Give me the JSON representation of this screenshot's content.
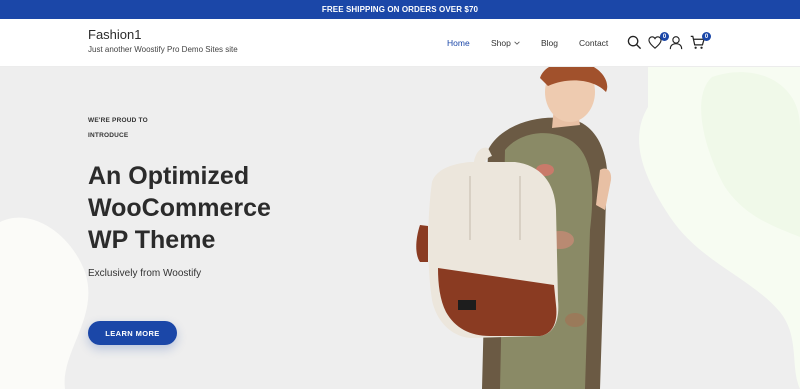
{
  "announcement": "FREE SHIPPING ON ORDERS OVER $70",
  "site": {
    "title": "Fashion1",
    "tagline": "Just another Woostify Pro Demo Sites site"
  },
  "nav": {
    "home": "Home",
    "shop": "Shop",
    "blog": "Blog",
    "contact": "Contact"
  },
  "header_icons": {
    "search": "search-icon",
    "wishlist": "heart-icon",
    "wishlist_count": "0",
    "account": "user-icon",
    "cart": "cart-icon",
    "cart_count": "0"
  },
  "hero": {
    "eyebrow_line1": "WE'RE PROUD TO",
    "eyebrow_line2": "INTRODUCE",
    "headline_line1": "An Optimized",
    "headline_line2": "WooCommerce",
    "headline_line3": "WP Theme",
    "subline": "Exclusively from Woostify",
    "cta": "LEARN MORE"
  },
  "colors": {
    "brand": "#1b47a8",
    "hero_bg": "#eeeeee",
    "text": "#2b2b2b"
  }
}
